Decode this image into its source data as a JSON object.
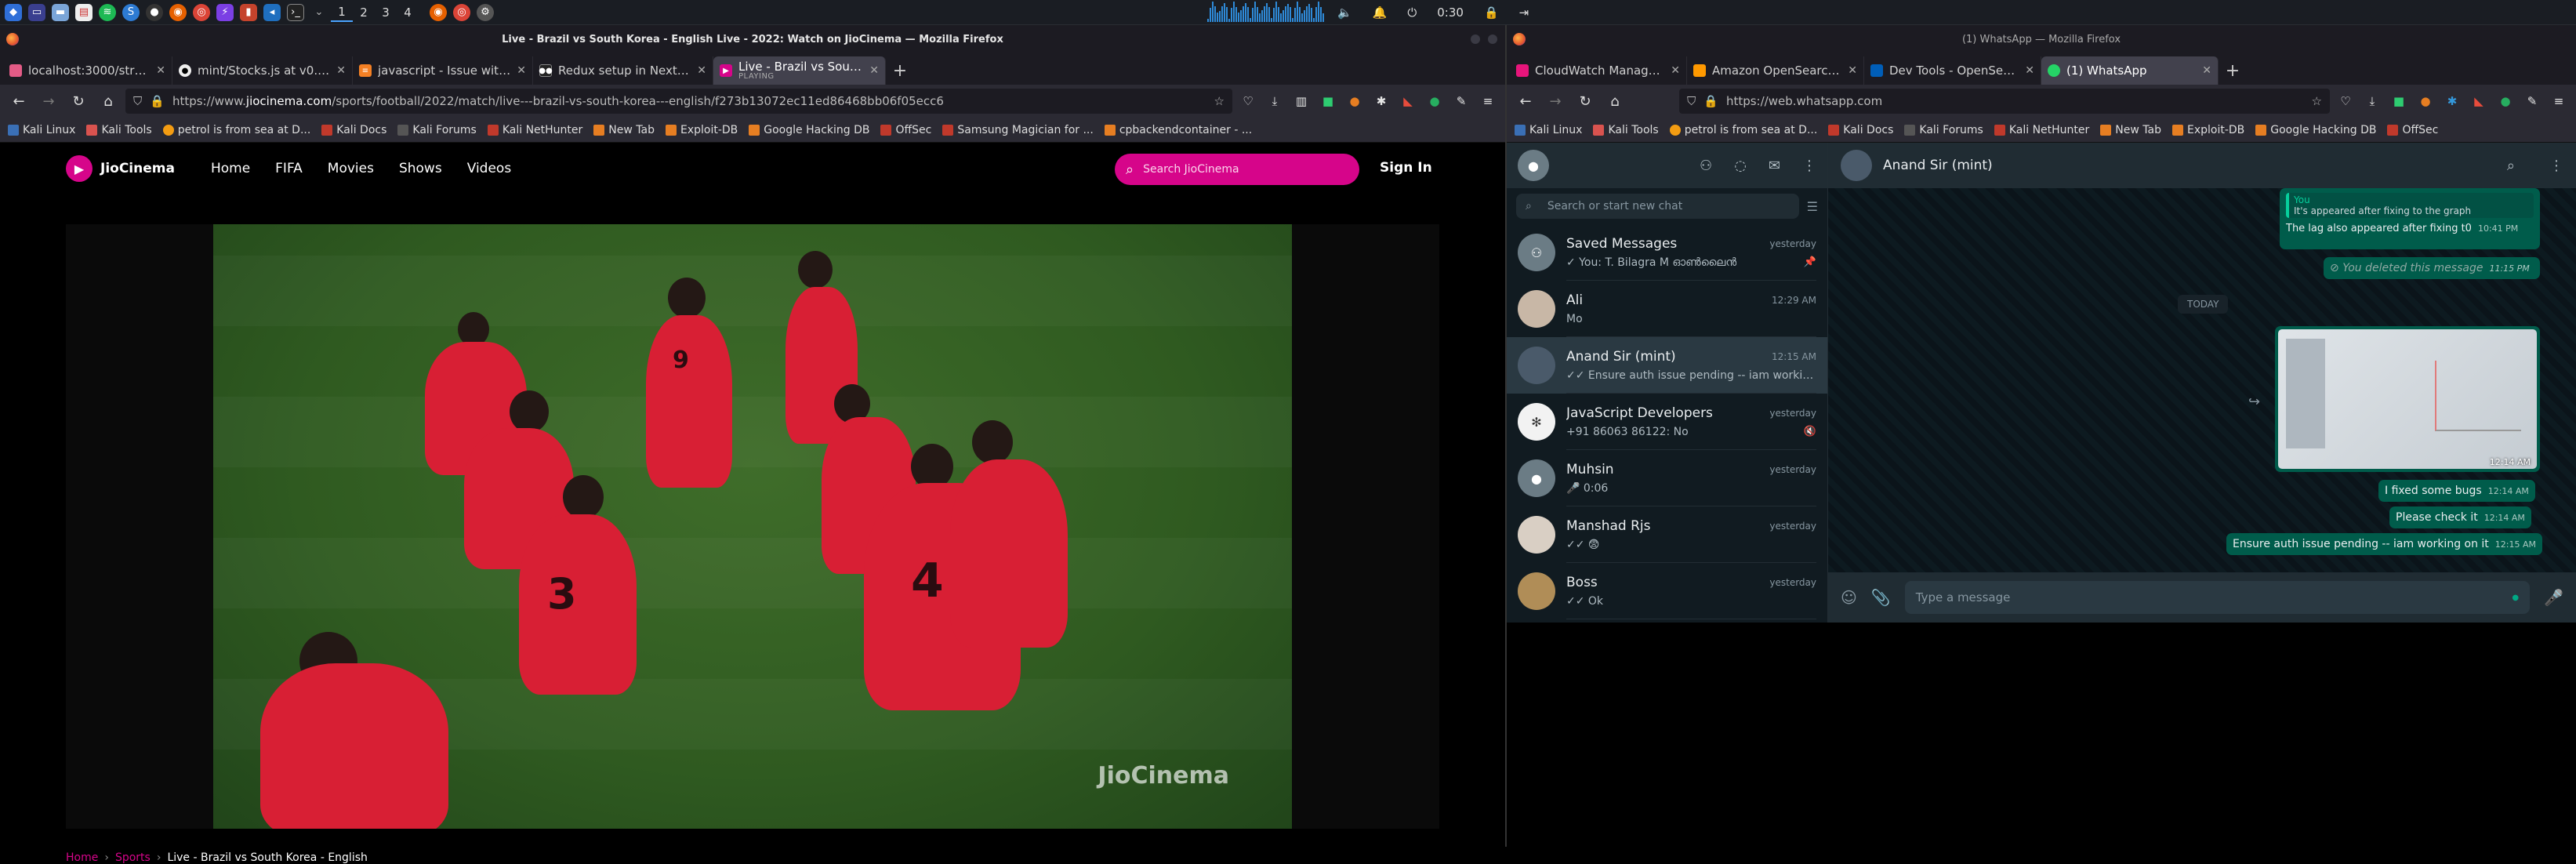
{
  "taskbar": {
    "workspaces": [
      "1",
      "2",
      "3",
      "4"
    ],
    "clock": "0:30"
  },
  "left_window": {
    "title": "Live - Brazil vs South Korea - English Live - 2022: Watch on JioCinema — Mozilla Firefox",
    "tabs": [
      {
        "label": "localhost:3000/strategy/n",
        "color": "#e35b86"
      },
      {
        "label": "mint/Stocks.js at v0.2.0 · m",
        "color": "#eeeeee"
      },
      {
        "label": "javascript - Issue with API",
        "color": "#f48024"
      },
      {
        "label": "Redux setup in NextJS | M",
        "color": "#222222"
      },
      {
        "label": "Live - Brazil vs South Kore",
        "color": "#d6058a",
        "sub": "PLAYING"
      }
    ],
    "url_prefix": "https://www.",
    "url_domain": "jiocinema.com",
    "url_rest": "/sports/football/2022/match/live---brazil-vs-south-korea---english/f273b13072ec11ed86468bb06f05ecc6",
    "bookmarks": [
      "Kali Linux",
      "Kali Tools",
      "petrol is from sea at D...",
      "Kali Docs",
      "Kali Forums",
      "Kali NetHunter",
      "New Tab",
      "Exploit-DB",
      "Google Hacking DB",
      "OffSec",
      "Samsung Magician for ...",
      "cpbackendcontainer - ..."
    ]
  },
  "jio": {
    "brand": "JioCinema",
    "nav": [
      "Home",
      "FIFA",
      "Movies",
      "Shows",
      "Videos"
    ],
    "search_placeholder": "Search JioCinema",
    "sign_in": "Sign In",
    "watermark": "JioCinema",
    "breadcrumb": {
      "home": "Home",
      "sports": "Sports",
      "current": "Live - Brazil vs South Korea - English"
    },
    "colors": {
      "accent": "#d6058a"
    }
  },
  "right_window": {
    "title": "(1) WhatsApp — Mozilla Firefox",
    "tabs": [
      {
        "label": "CloudWatch Managemen",
        "color": "#e7157b"
      },
      {
        "label": "Amazon OpenSearch Serv",
        "color": "#f90"
      },
      {
        "label": "Dev Tools - OpenSearch",
        "color": "#005eb8"
      },
      {
        "label": "(1) WhatsApp",
        "color": "#25d366"
      }
    ],
    "url": "https://web.whatsapp.com",
    "bookmarks": [
      "Kali Linux",
      "Kali Tools",
      "petrol is from sea at D...",
      "Kali Docs",
      "Kali Forums",
      "Kali NetHunter",
      "New Tab",
      "Exploit-DB",
      "Google Hacking DB",
      "OffSec"
    ]
  },
  "whatsapp": {
    "search_placeholder": "Search or start new chat",
    "chats": [
      {
        "name": "Saved Messages",
        "time": "yesterday",
        "preview": "✓ You: T. Bilagra M ഓൺലൈൻ",
        "avatar": "#6b7c85"
      },
      {
        "name": "Ali",
        "time": "12:29 AM",
        "preview": "Mo",
        "avatar": "#c8b7a6"
      },
      {
        "name": "Anand Sir (mint)",
        "time": "12:15 AM",
        "preview": "✓✓ Ensure auth issue pending -- iam working on it",
        "avatar": "#4a5a6a"
      },
      {
        "name": "JavaScript Developers",
        "time": "yesterday",
        "preview": "+91 86063 86122: No",
        "avatar": "#f2f2f2"
      },
      {
        "name": "Muhsin",
        "time": "yesterday",
        "preview": "🎤 0:06",
        "avatar": "#6b7c85"
      },
      {
        "name": "Manshad Rjs",
        "time": "yesterday",
        "preview": "✓✓ 😨",
        "avatar": "#d9cfc4"
      },
      {
        "name": "Boss",
        "time": "yesterday",
        "preview": "✓✓ Ok",
        "avatar": "#b08d57"
      }
    ],
    "active_chat": "Anand Sir (mint)",
    "messages": {
      "quote_author": "You",
      "quote_text": "It's appeared after fixing to the graph",
      "m1": "The lag also appeared after fixing t0",
      "m1_time": "10:41 PM",
      "deleted": "You deleted this message",
      "deleted_time": "11:15 PM",
      "date_chip": "TODAY",
      "image_time": "12:14 AM",
      "m2": "I fixed some bugs",
      "m2_time": "12:14 AM",
      "m3": "Please check it",
      "m3_time": "12:14 AM",
      "m4": "Ensure auth issue pending -- iam working on it",
      "m4_time": "12:15 AM"
    },
    "composer_placeholder": "Type a message"
  }
}
